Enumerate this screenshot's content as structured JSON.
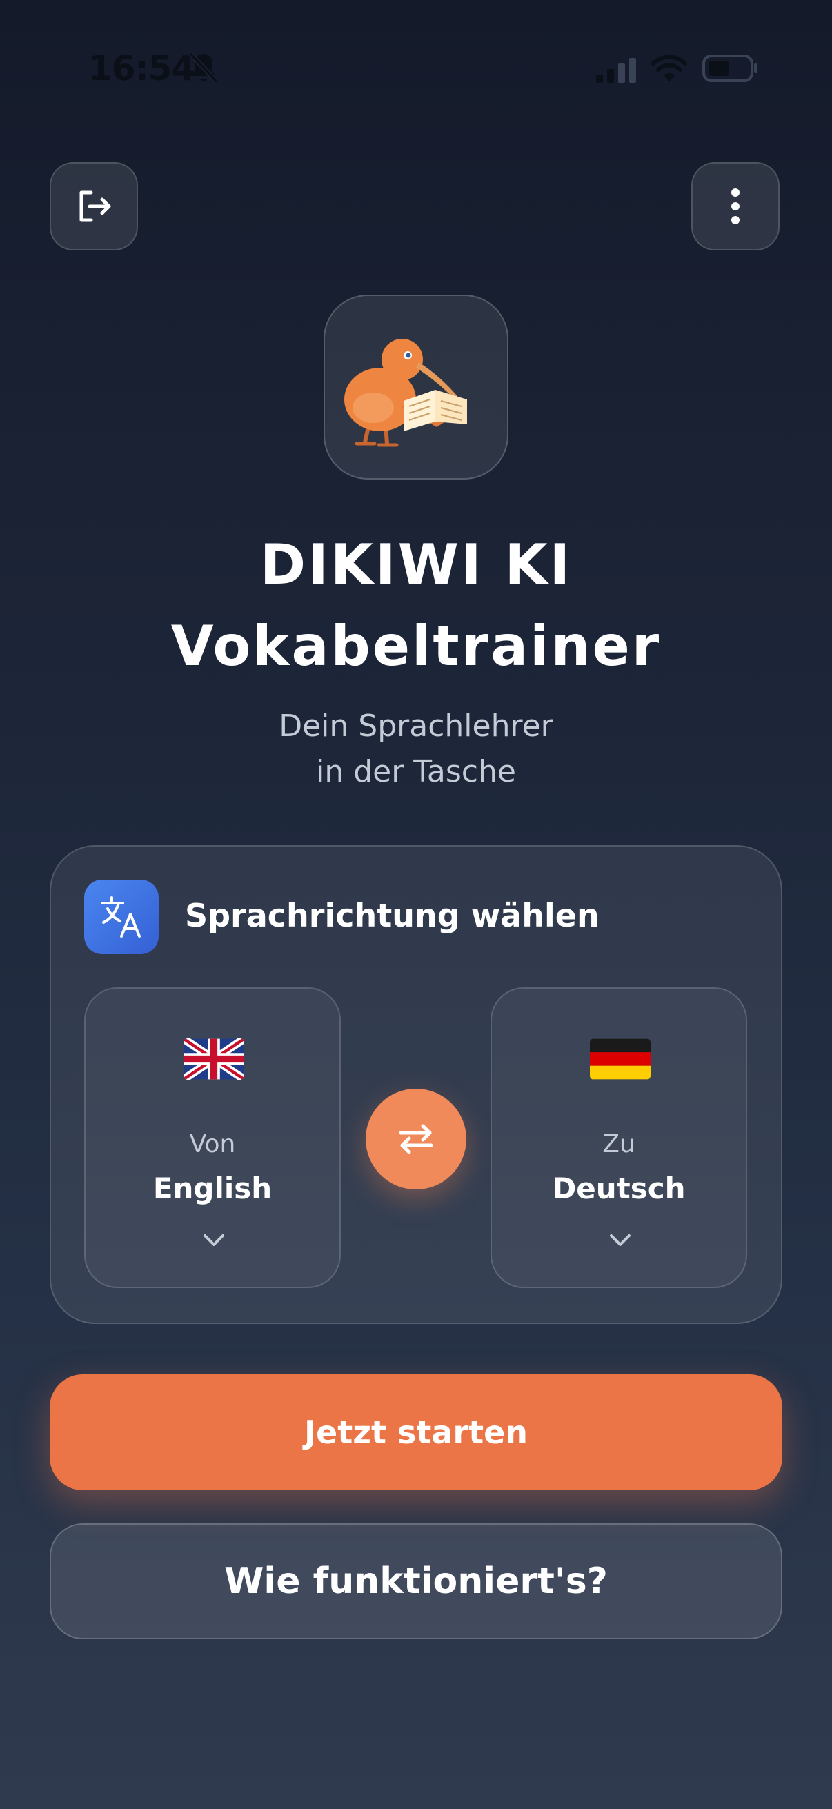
{
  "status_bar": {
    "time": "16:54",
    "icons": [
      "bell-slash-icon",
      "signal-icon",
      "wifi-icon",
      "battery-icon"
    ]
  },
  "header": {
    "logout_icon": "logout-icon",
    "menu_icon": "vertical-dots-icon"
  },
  "logo": {
    "icon": "kiwi-bird-reading-book"
  },
  "title": {
    "line1": "DIKIWI KI",
    "line2": "Vokabeltrainer"
  },
  "subtitle": {
    "line1": "Dein Sprachlehrer",
    "line2": "in der Tasche"
  },
  "language_card": {
    "heading": "Sprachrichtung wählen",
    "heading_icon": "translate-icon",
    "from": {
      "caption": "Von",
      "language": "English",
      "flag": "uk-flag-icon"
    },
    "to": {
      "caption": "Zu",
      "language": "Deutsch",
      "flag": "germany-flag-icon"
    },
    "swap_icon": "swap-arrows-icon"
  },
  "actions": {
    "start": "Jetzt starten",
    "how": "Wie funktioniert's?"
  },
  "colors": {
    "accent": "#ec7547",
    "swap": "#f08a5a",
    "badge": "#3f72e2",
    "background_top": "#141a2a",
    "background_bottom": "#303a4e"
  }
}
